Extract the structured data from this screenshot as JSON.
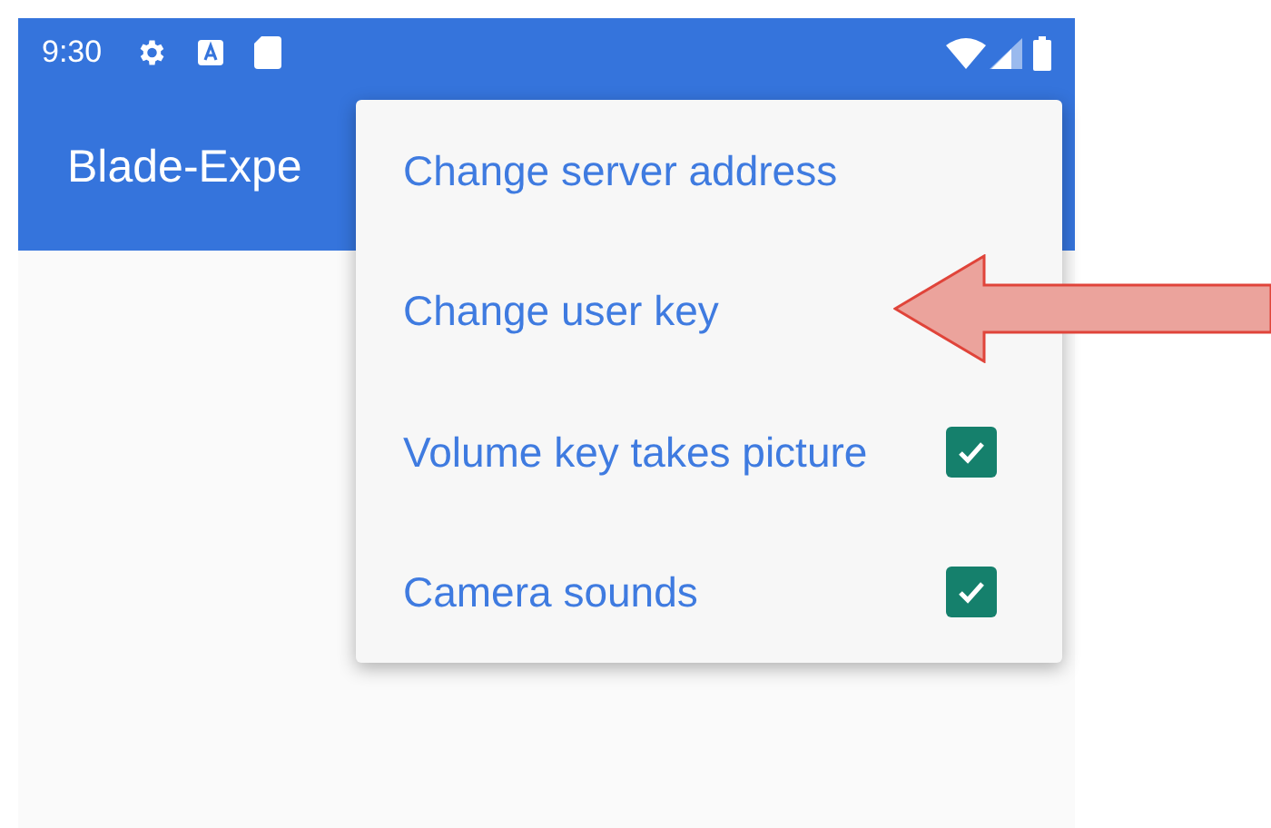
{
  "status_bar": {
    "time": "9:30"
  },
  "app_bar": {
    "title": "Blade-Expe"
  },
  "menu": {
    "items": [
      {
        "kind": "action",
        "label": "Change server address"
      },
      {
        "kind": "action",
        "label": "Change user key"
      },
      {
        "kind": "checkbox",
        "label": "Volume key takes picture",
        "checked": true
      },
      {
        "kind": "checkbox",
        "label": "Camera sounds",
        "checked": true
      }
    ]
  }
}
